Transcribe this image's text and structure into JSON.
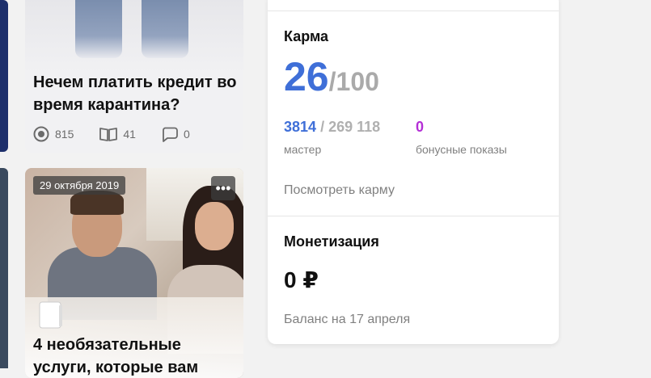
{
  "articles": [
    {
      "title": "Нечем платить кредит во время карантина?",
      "views": "815",
      "reads": "41",
      "comments": "0"
    },
    {
      "date": "29 октября 2019",
      "more_label": "•••",
      "title": "4 необязательные услуги, которые вам"
    }
  ],
  "karma": {
    "title": "Карма",
    "value": "26",
    "max": "/100",
    "rank_position": "3814",
    "rank_total": "/ 269 118",
    "rank_label": "мастер",
    "bonus_value": "0",
    "bonus_label": "бонусные показы",
    "view_link": "Посмотреть карму"
  },
  "monetization": {
    "title": "Монетизация",
    "amount": "0 ₽",
    "balance_label": "Баланс на 17 апреля"
  },
  "colors": {
    "accent_blue": "#3f6fd8",
    "bonus_purple": "#b42fd6",
    "muted_gray": "#808080"
  }
}
